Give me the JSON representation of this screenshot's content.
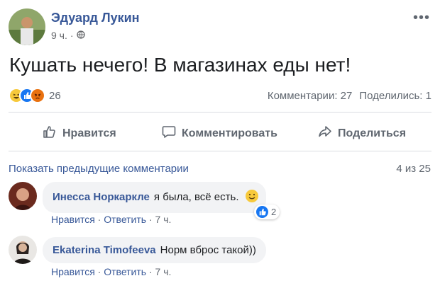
{
  "post": {
    "author": "Эдуард Лукин",
    "time": "9 ч.",
    "separator": "·",
    "text": "Кушать нечего! В магазинах еды нет!",
    "reaction_count": "26",
    "reaction_icons": [
      "haha-icon",
      "like-icon",
      "angry-icon"
    ],
    "comments_stat": "Комментарии: 27",
    "shares_stat": "Поделились: 1"
  },
  "actions": {
    "like": "Нравится",
    "comment": "Комментировать",
    "share": "Поделиться"
  },
  "comments_section": {
    "show_previous": "Показать предыдущие комментарии",
    "pager": "4 из 25",
    "comments": [
      {
        "name": "Инесса Норкаркле",
        "text": "я была, всё есть.",
        "emoji": "slightly-smiling-face-icon",
        "like": "Нравится",
        "reply": "Ответить",
        "sep": "·",
        "time": "7 ч.",
        "reaction_count": "2"
      },
      {
        "name": "Ekaterina Timofeeva",
        "text": "Норм вброс такой))",
        "like": "Нравится",
        "reply": "Ответить",
        "sep": "·",
        "time": "7 ч."
      }
    ]
  },
  "colors": {
    "link": "#385898",
    "secondary": "#606770",
    "bubble": "#f2f3f5",
    "like_blue": "#1877f2",
    "angry": "#e9710f"
  }
}
